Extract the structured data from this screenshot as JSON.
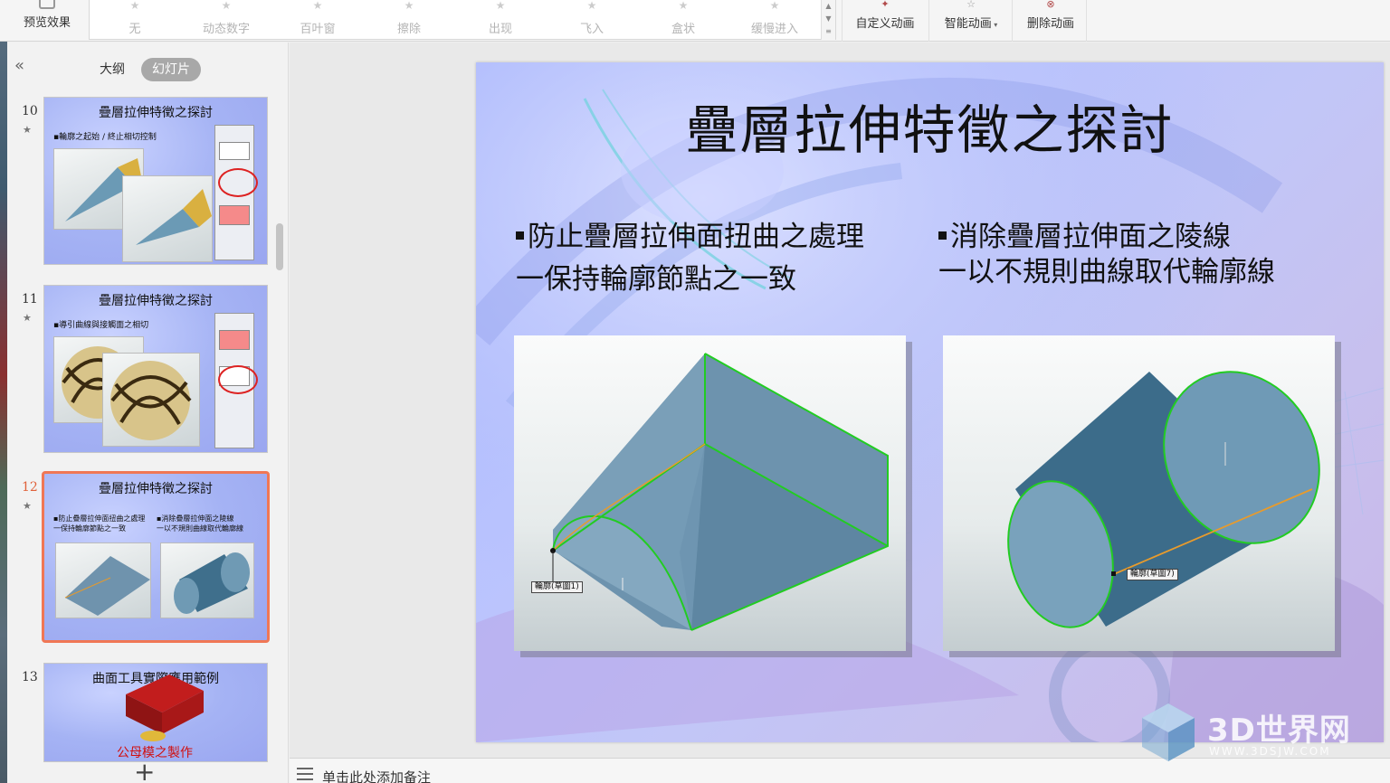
{
  "ribbon": {
    "preview_label": "预览效果",
    "animations": [
      "无",
      "动态数字",
      "百叶窗",
      "擦除",
      "出现",
      "飞入",
      "盒状",
      "缓慢进入"
    ],
    "custom_anim_label": "自定义动画",
    "smart_anim_label": "智能动画",
    "delete_anim_label": "删除动画"
  },
  "left_pane": {
    "tab_outline": "大纲",
    "tab_slides": "幻灯片",
    "slides": [
      {
        "num": "10",
        "title": "疊層拉伸特徵之探討",
        "sub1": "▪輪廓之起始 / 終止相切控制",
        "sub2": ""
      },
      {
        "num": "11",
        "title": "疊層拉伸特徵之探討",
        "sub1": "▪導引曲線與接觸面之相切",
        "sub2": ""
      },
      {
        "num": "12",
        "title": "疊層拉伸特徵之探討",
        "sub1": "▪防止疊層拉伸面扭曲之處理",
        "sub1b": "一保持輪廓節點之一致",
        "sub2": "▪消除疊層拉伸面之陵線",
        "sub2b": "一以不規則曲線取代輪廓線"
      },
      {
        "num": "13",
        "title": "曲面工具實際應用範例",
        "red_caption": "公母模之製作"
      }
    ],
    "add_slide_icon": "+"
  },
  "slide": {
    "title": "疊層拉伸特徵之探討",
    "left_bullet": "防止疊層拉伸面扭曲之處理",
    "left_sub": "一保持輪廓節點之一致",
    "right_bullet": "消除疊層拉伸面之陵線",
    "right_sub": "一以不規則曲線取代輪廓線",
    "img1_label": "輪廓(草圖1)",
    "img2_label": "輪廓(草圖7)"
  },
  "notes": {
    "placeholder": "单击此处添加备注"
  },
  "watermark": {
    "text": "3D世界网",
    "url": "WWW.3DSJW.COM"
  },
  "colors": {
    "accent": "#f07755",
    "slide_bg": "#b9c3ff",
    "solid_blue": "#5f8aa8",
    "edge_green": "#2ecc2e",
    "line_orange": "#f0a030"
  }
}
